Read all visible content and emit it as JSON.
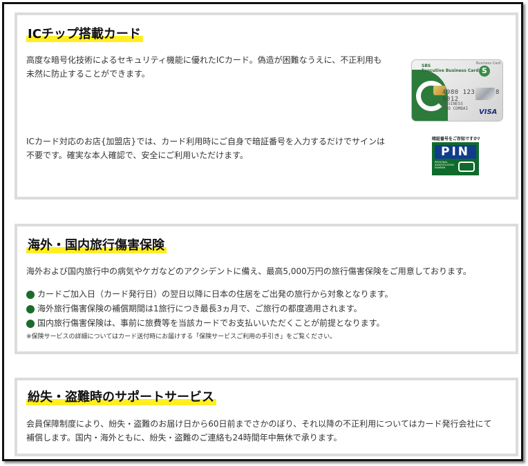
{
  "sections": {
    "ic": {
      "title": "ICチップ搭載カード",
      "para1_line1": "高度な暗号化技術によるセキュリティ機能に優れたICカード。偽造が困難なうえに、不正利用も",
      "para1_line2": "未然に防止することができます。",
      "para2_line1": "ICカード対応のお店{加盟店}では、カード利用時にご自身で暗証番号を入力するだけでサインは",
      "para2_line2": "不要です。確実な本人確認で、安全にご利用いただけます。",
      "card": {
        "brand_line1": "SBS",
        "brand_line2": "Executive Business Card",
        "type": "Business Card",
        "number": "4980 1234 5678 9012",
        "holder_line1": "BUSINESS",
        "holder_line2": "MOD COMBAI",
        "network": "VISA",
        "logo_letter": "S"
      },
      "pin": {
        "caption": "暗証番号をご存知ですか?",
        "letters": "PIN",
        "sub_line1": "PERSONAL",
        "sub_line2": "IDENTIFICATION",
        "sub_line3": "NUMBER"
      }
    },
    "travel": {
      "title": "海外・国内旅行傷害保険",
      "para": "海外および国内旅行中の病気やケガなどのアクシデントに備え、最高5,000万円の旅行傷害保険をご用意しております。",
      "bullets": [
        "カードご加入日（カード発行日）の翌日以降に日本の住居をご出発の旅行から対象となります。",
        "海外旅行傷害保険の補償期間は1旅行につき最長3ヵ月で、ご旅行の都度適用されます。",
        "国内旅行傷害保険は、事前に旅費等を当該カードでお支払いいただくことが前提となります。"
      ],
      "note": "※保険サービスの詳細についてはカード送付時にお届けする「保険サービスご利用の手引き」をご覧ください。"
    },
    "support": {
      "title": "紛失・盗難時のサポートサービス",
      "para_line1": "会員保障制度により、紛失・盗難のお届け日から60日前までさかのぼり、それ以降の不正利用についてはカード発行会社にて",
      "para_line2": "補償します。国内・海外ともに、紛失・盗難のご連絡も24時間年中無休で承ります。"
    }
  },
  "colors": {
    "highlight": "#ffee22",
    "bullet_green": "#1d6b2a",
    "section_border": "#dcdcdc"
  }
}
